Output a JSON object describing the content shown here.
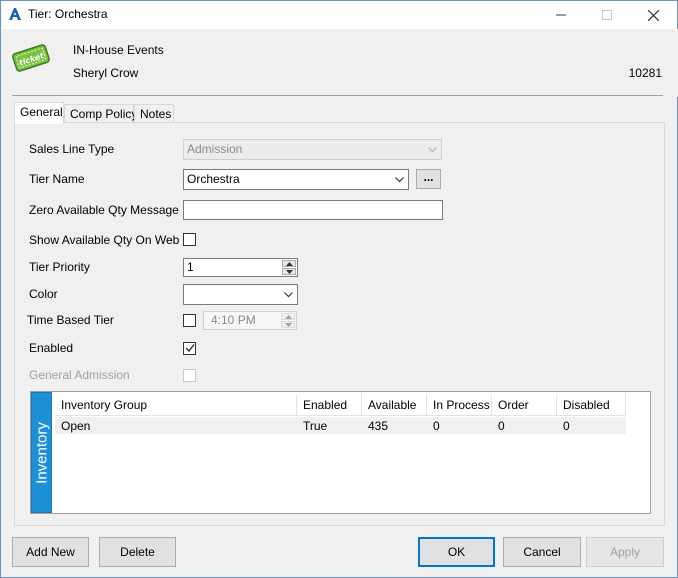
{
  "window": {
    "title": "Tier: Orchestra",
    "controls": {
      "minimize": "—",
      "maximize": "☐",
      "close": "✕"
    }
  },
  "header": {
    "event_name": "IN-House Events",
    "performer": "Sheryl Crow",
    "event_id": "10281",
    "icon_text": "ticket"
  },
  "tabs": [
    {
      "label": "General",
      "active": true
    },
    {
      "label": "Comp Policy",
      "active": false
    },
    {
      "label": "Notes",
      "active": false
    }
  ],
  "form": {
    "sales_line_type": {
      "label": "Sales Line Type",
      "value": "Admission"
    },
    "tier_name": {
      "label": "Tier Name",
      "value": "Orchestra",
      "more_button": "..."
    },
    "zero_available_msg": {
      "label": "Zero Available Qty Message",
      "value": ""
    },
    "show_available_on_web": {
      "label": "Show Available Qty On Web",
      "checked": false
    },
    "tier_priority": {
      "label": "Tier Priority",
      "value": "1"
    },
    "color": {
      "label": "Color",
      "value": ""
    },
    "time_based_tier": {
      "label": "Time Based Tier",
      "checked": false,
      "time": "4:10 PM"
    },
    "enabled": {
      "label": "Enabled",
      "checked": true
    },
    "general_admission": {
      "label": "General Admission",
      "checked": false
    }
  },
  "inventory": {
    "tab_label": "Inventory",
    "columns": [
      "Inventory Group",
      "Enabled",
      "Available",
      "In Process",
      "Order",
      "Disabled"
    ],
    "rows": [
      [
        "Open",
        "True",
        "435",
        "0",
        "0",
        "0"
      ]
    ]
  },
  "buttons": {
    "add_new": "Add New",
    "delete": "Delete",
    "ok": "OK",
    "cancel": "Cancel",
    "apply": "Apply"
  },
  "colors": {
    "accent": "#0078d7",
    "inventory_tab": "#1e90d8",
    "ticket_green": "#7cc242"
  }
}
